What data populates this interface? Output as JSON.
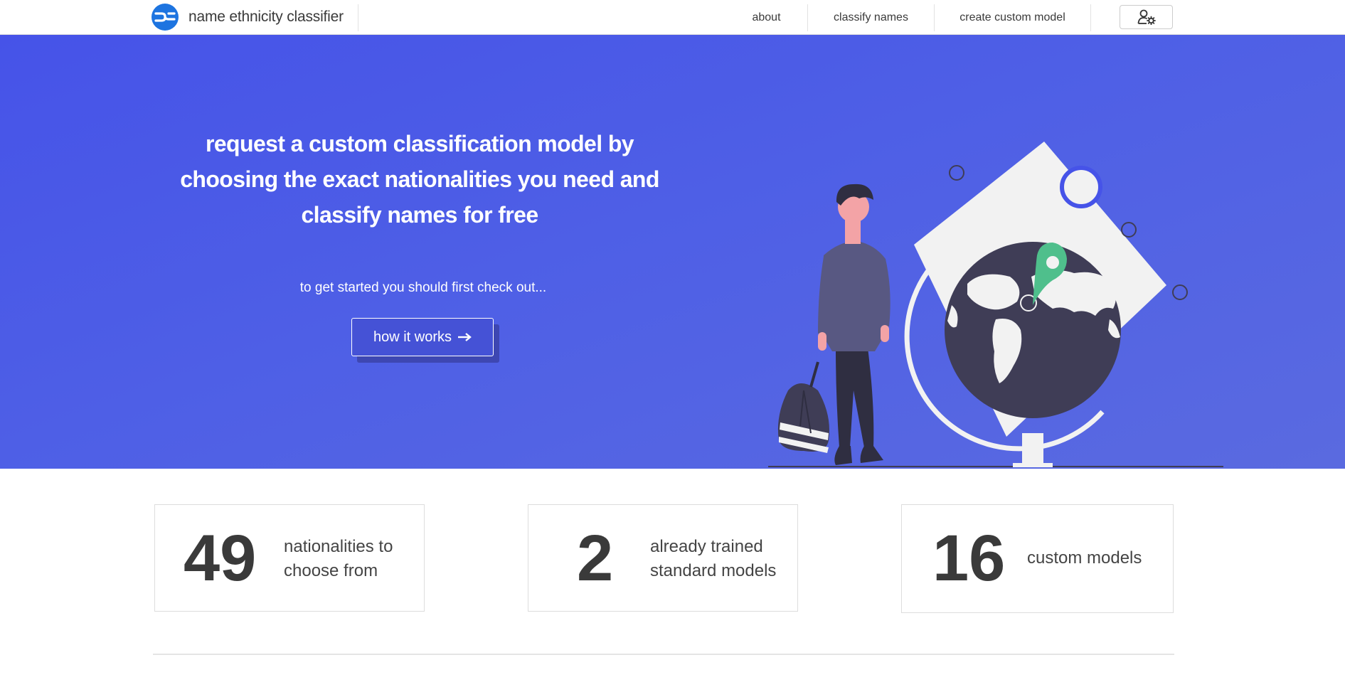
{
  "navbar": {
    "brand": "name ethnicity classifier",
    "links": [
      "about",
      "classify names",
      "create custom model"
    ],
    "account_icon": "user-cog-icon"
  },
  "hero": {
    "title": "request a custom classification model by choosing the exact nationalities you need and classify names for free",
    "subtitle": "to get started you should first check out...",
    "button_label": "how it works",
    "button_icon": "arrow-right-icon"
  },
  "stats": [
    {
      "number": "49",
      "label": "nationalities to choose from"
    },
    {
      "number": "2",
      "label": "already trained standard models"
    },
    {
      "number": "16",
      "label": "custom models"
    }
  ],
  "colors": {
    "hero_bg": "#4653e8",
    "brand_blue": "#1d74e0",
    "pin_green": "#4fbf8c",
    "globe_dark": "#3f3d56"
  }
}
